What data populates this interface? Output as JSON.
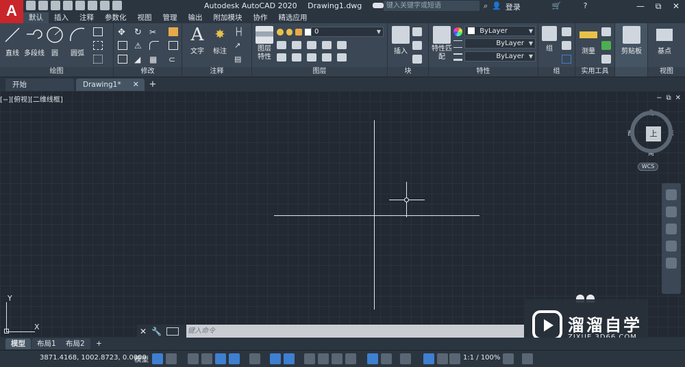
{
  "app": {
    "logo_letter": "A",
    "title": "Autodesk AutoCAD 2020",
    "document": "Drawing1.dwg",
    "search_placeholder": "键入关键字或短语",
    "login": "登录",
    "win_min": "—",
    "win_max": "⧉",
    "win_close": "✕"
  },
  "ribbon_tabs": [
    "默认",
    "插入",
    "注释",
    "参数化",
    "视图",
    "管理",
    "输出",
    "附加模块",
    "协作",
    "精选应用"
  ],
  "ribbon": {
    "draw": {
      "title": "绘图",
      "line": "直线",
      "polyline": "多段线",
      "circle": "圆",
      "arc": "圆弧"
    },
    "modify": {
      "title": "修改"
    },
    "annotation": {
      "title": "注释",
      "text": "文字",
      "dimension": "标注"
    },
    "layers": {
      "title": "图层",
      "props": "图层特性",
      "current_layer": "0"
    },
    "block": {
      "title": "块",
      "insert": "插入"
    },
    "properties": {
      "title": "特性",
      "match": "特性匹配",
      "color": "ByLayer",
      "linetype": "ByLayer",
      "lineweight": "ByLayer"
    },
    "groups": {
      "title": "组",
      "group": "组"
    },
    "utilities": {
      "title": "实用工具",
      "measure": "测量"
    },
    "clipboard": {
      "title": "剪贴板"
    },
    "view": {
      "title": "视图",
      "base": "基点"
    }
  },
  "doc_tabs": {
    "start": "开始",
    "drawing": "Drawing1*",
    "add": "+",
    "close": "✕"
  },
  "viewport": {
    "label": "[−][俯视][二维线框]",
    "compass": {
      "north": "北",
      "south": "南",
      "east": "东",
      "west": "西",
      "face": "上"
    },
    "wcs": "WCS",
    "ucs_y": "Y",
    "ucs_x": "X"
  },
  "command_line": {
    "placeholder": "键入命令"
  },
  "layout_tabs": {
    "model": "模型",
    "layout1": "布局1",
    "layout2": "布局2",
    "add": "+"
  },
  "status": {
    "coords": "3871.4168, 1002.8723, 0.0000",
    "model": "模型",
    "scale": "1:1 / 100%"
  },
  "watermark": {
    "name": "溜溜自学",
    "url": "ZIXUE.3D66.COM"
  },
  "colors": {
    "accent": "#3f7fcf",
    "logo": "#c8262a",
    "canvas": "#222932"
  }
}
